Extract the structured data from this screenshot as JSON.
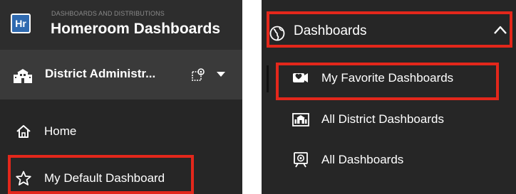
{
  "left_panel": {
    "brand": {
      "logo_text": "Hr",
      "subtitle": "DASHBOARDS AND DISTRIBUTIONS",
      "title": "Homeroom Dashboards"
    },
    "district": {
      "label": "District Administr...",
      "icon": "district-building-icon",
      "settings_icon": "edit-settings-icon",
      "caret_icon": "caret-down-icon"
    },
    "nav": [
      {
        "label": "Home",
        "icon": "home-icon"
      },
      {
        "label": "My Default Dashboard",
        "icon": "star-icon",
        "highlighted": true
      }
    ]
  },
  "right_panel": {
    "section": {
      "label": "Dashboards",
      "icon": "globe-icon",
      "expanded": true,
      "chevron_icon": "chevron-up-icon",
      "highlighted": true
    },
    "items": [
      {
        "label": "My Favorite Dashboards",
        "icon": "favorite-heart-icon",
        "highlighted": true,
        "active": true
      },
      {
        "label": "All District Dashboards",
        "icon": "district-icon"
      },
      {
        "label": "All Dashboards",
        "icon": "all-dashboards-icon"
      }
    ]
  },
  "colors": {
    "panel_background": "#262626",
    "brand_background": "#2d2d2d",
    "district_background": "#3a3a3a",
    "logo_blue": "#2f6ab0",
    "highlight_red": "#e3271b",
    "text": "#ffffff"
  }
}
